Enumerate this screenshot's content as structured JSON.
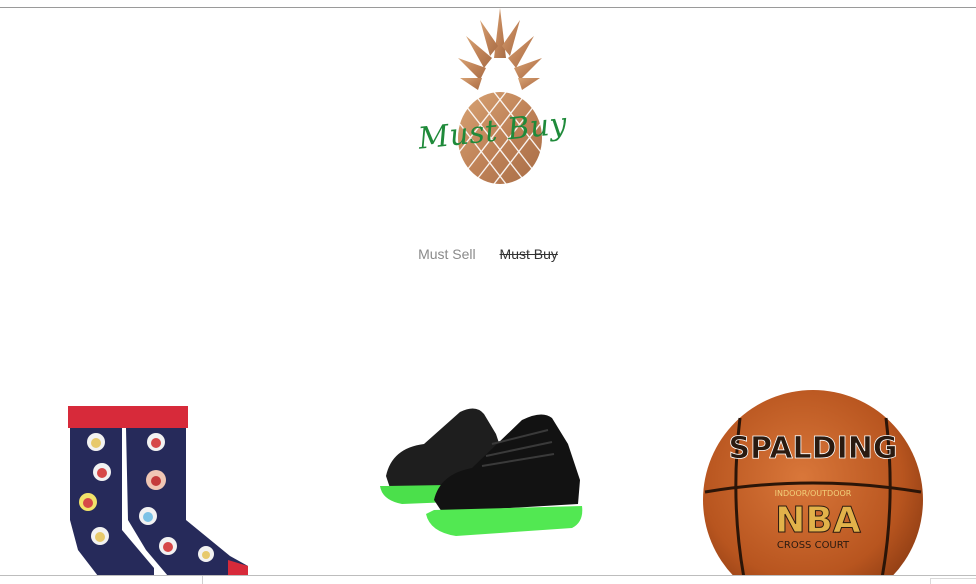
{
  "brand": {
    "logo_text": "Must Buy",
    "logo_color": "#1f8a3a",
    "pineapple_color": "#c9915f"
  },
  "nav": {
    "links": [
      {
        "label": "Must Sell",
        "active": false
      },
      {
        "label": "Must Buy",
        "active": true
      }
    ]
  },
  "products": [
    {
      "name": "socks-image"
    },
    {
      "name": "light-up-sneakers-image"
    },
    {
      "name": "basketball-image"
    }
  ],
  "basketball": {
    "brand_text": "SPALDING",
    "league_text": "NBA",
    "model_text": "CROSS COURT",
    "tag_text": "INDOOR/OUTDOOR"
  }
}
